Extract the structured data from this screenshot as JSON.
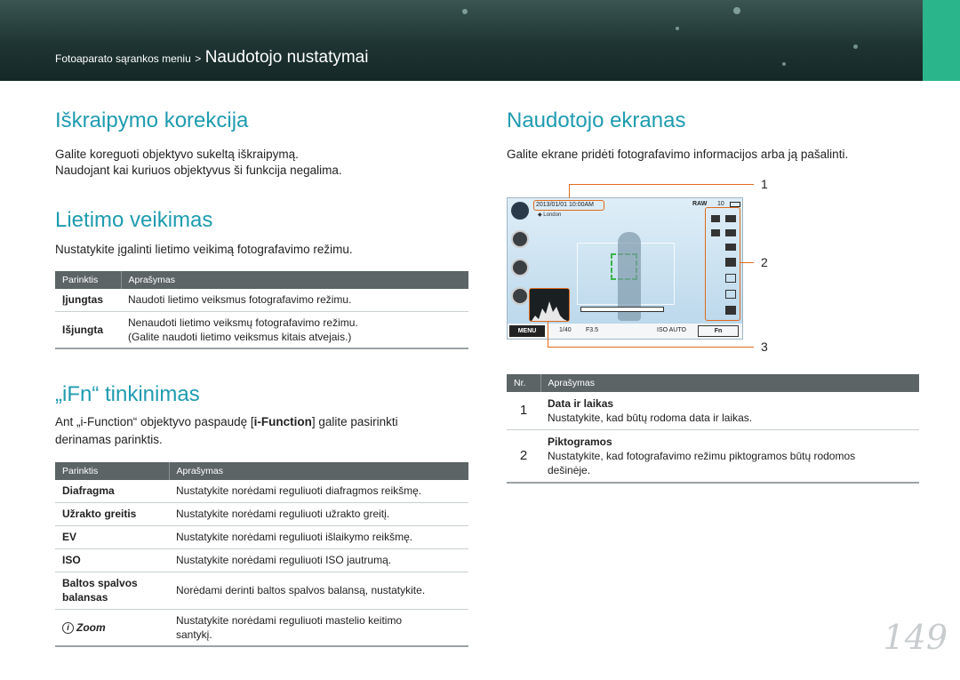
{
  "header": {
    "breadcrumb_parent": "Fotoaparato sąrankos meniu",
    "separator": ">",
    "breadcrumb_current": "Naudotojo nustatymai"
  },
  "left": {
    "distortion": {
      "title": "Iškraipymo korekcija",
      "line1": "Galite koreguoti objektyvo sukeltą iškraipymą.",
      "line2": "Naudojant kai kuriuos objektyvus ši funkcija negalima."
    },
    "touch": {
      "title": "Lietimo veikimas",
      "desc": "Nustatykite įgalinti lietimo veikimą fotografavimo režimu.",
      "headers": [
        "Parinktis",
        "Aprašymas"
      ],
      "rows": [
        {
          "option": "Įjungtas",
          "desc": "Naudoti lietimo veiksmus fotografavimo režimu."
        },
        {
          "option": "Išjungta",
          "desc": "Nenaudoti lietimo veiksmų fotografavimo režimu.",
          "desc2": "(Galite naudoti lietimo veiksmus kitais atvejais.)"
        }
      ]
    },
    "ifn": {
      "title": "„iFn“ tinkinimas",
      "desc_pre": "Ant „i-Function“ objektyvo paspaudę [",
      "desc_bold": "i-Function",
      "desc_post": "] galite pasirinkti",
      "desc_line2": "derinamas parinktis.",
      "headers": [
        "Parinktis",
        "Aprašymas"
      ],
      "rows": [
        {
          "option": "Diafragma",
          "desc": "Nustatykite norėdami reguliuoti diafragmos reikšmę."
        },
        {
          "option": "Užrakto greitis",
          "desc": "Nustatykite norėdami reguliuoti užrakto greitį."
        },
        {
          "option": "EV",
          "desc": "Nustatykite norėdami reguliuoti išlaikymo reikšmę."
        },
        {
          "option": "ISO",
          "desc": "Nustatykite norėdami reguliuoti ISO jautrumą."
        },
        {
          "option": "Baltos spalvos",
          "option2": "balansas",
          "desc": "Norėdami derinti baltos spalvos balansą, nustatykite."
        },
        {
          "option": "Zoom",
          "desc": "Nustatykite norėdami reguliuoti mastelio keitimo",
          "desc2": "santykį."
        }
      ]
    }
  },
  "right": {
    "title": "Naudotojo ekranas",
    "desc": "Galite ekrane pridėti fotografavimo informacijos arba ją pašalinti.",
    "screen": {
      "datetime": "2013/01/01 10:00AM",
      "location": "London",
      "shots": "10",
      "menu": "MENU",
      "shutter": "1/40",
      "aperture": "F3.5",
      "iso": "ISO AUTO",
      "fn": "Fn",
      "callouts": [
        "1",
        "2",
        "3"
      ]
    },
    "headers": [
      "Nr.",
      "Aprašymas"
    ],
    "rows": [
      {
        "nr": "1",
        "title": "Data ir laikas",
        "desc": "Nustatykite, kad būtų rodoma data ir laikas."
      },
      {
        "nr": "2",
        "title": "Piktogramos",
        "desc": "Nustatykite, kad fotografavimo režimu piktogramos būtų rodomos",
        "desc2": "dešinėje."
      }
    ]
  },
  "page_number": "149",
  "colors": {
    "heading": "#1f9bb0",
    "table_header": "#5c6466",
    "callout": "#e06a1c",
    "header_bg": "#1e3433"
  }
}
